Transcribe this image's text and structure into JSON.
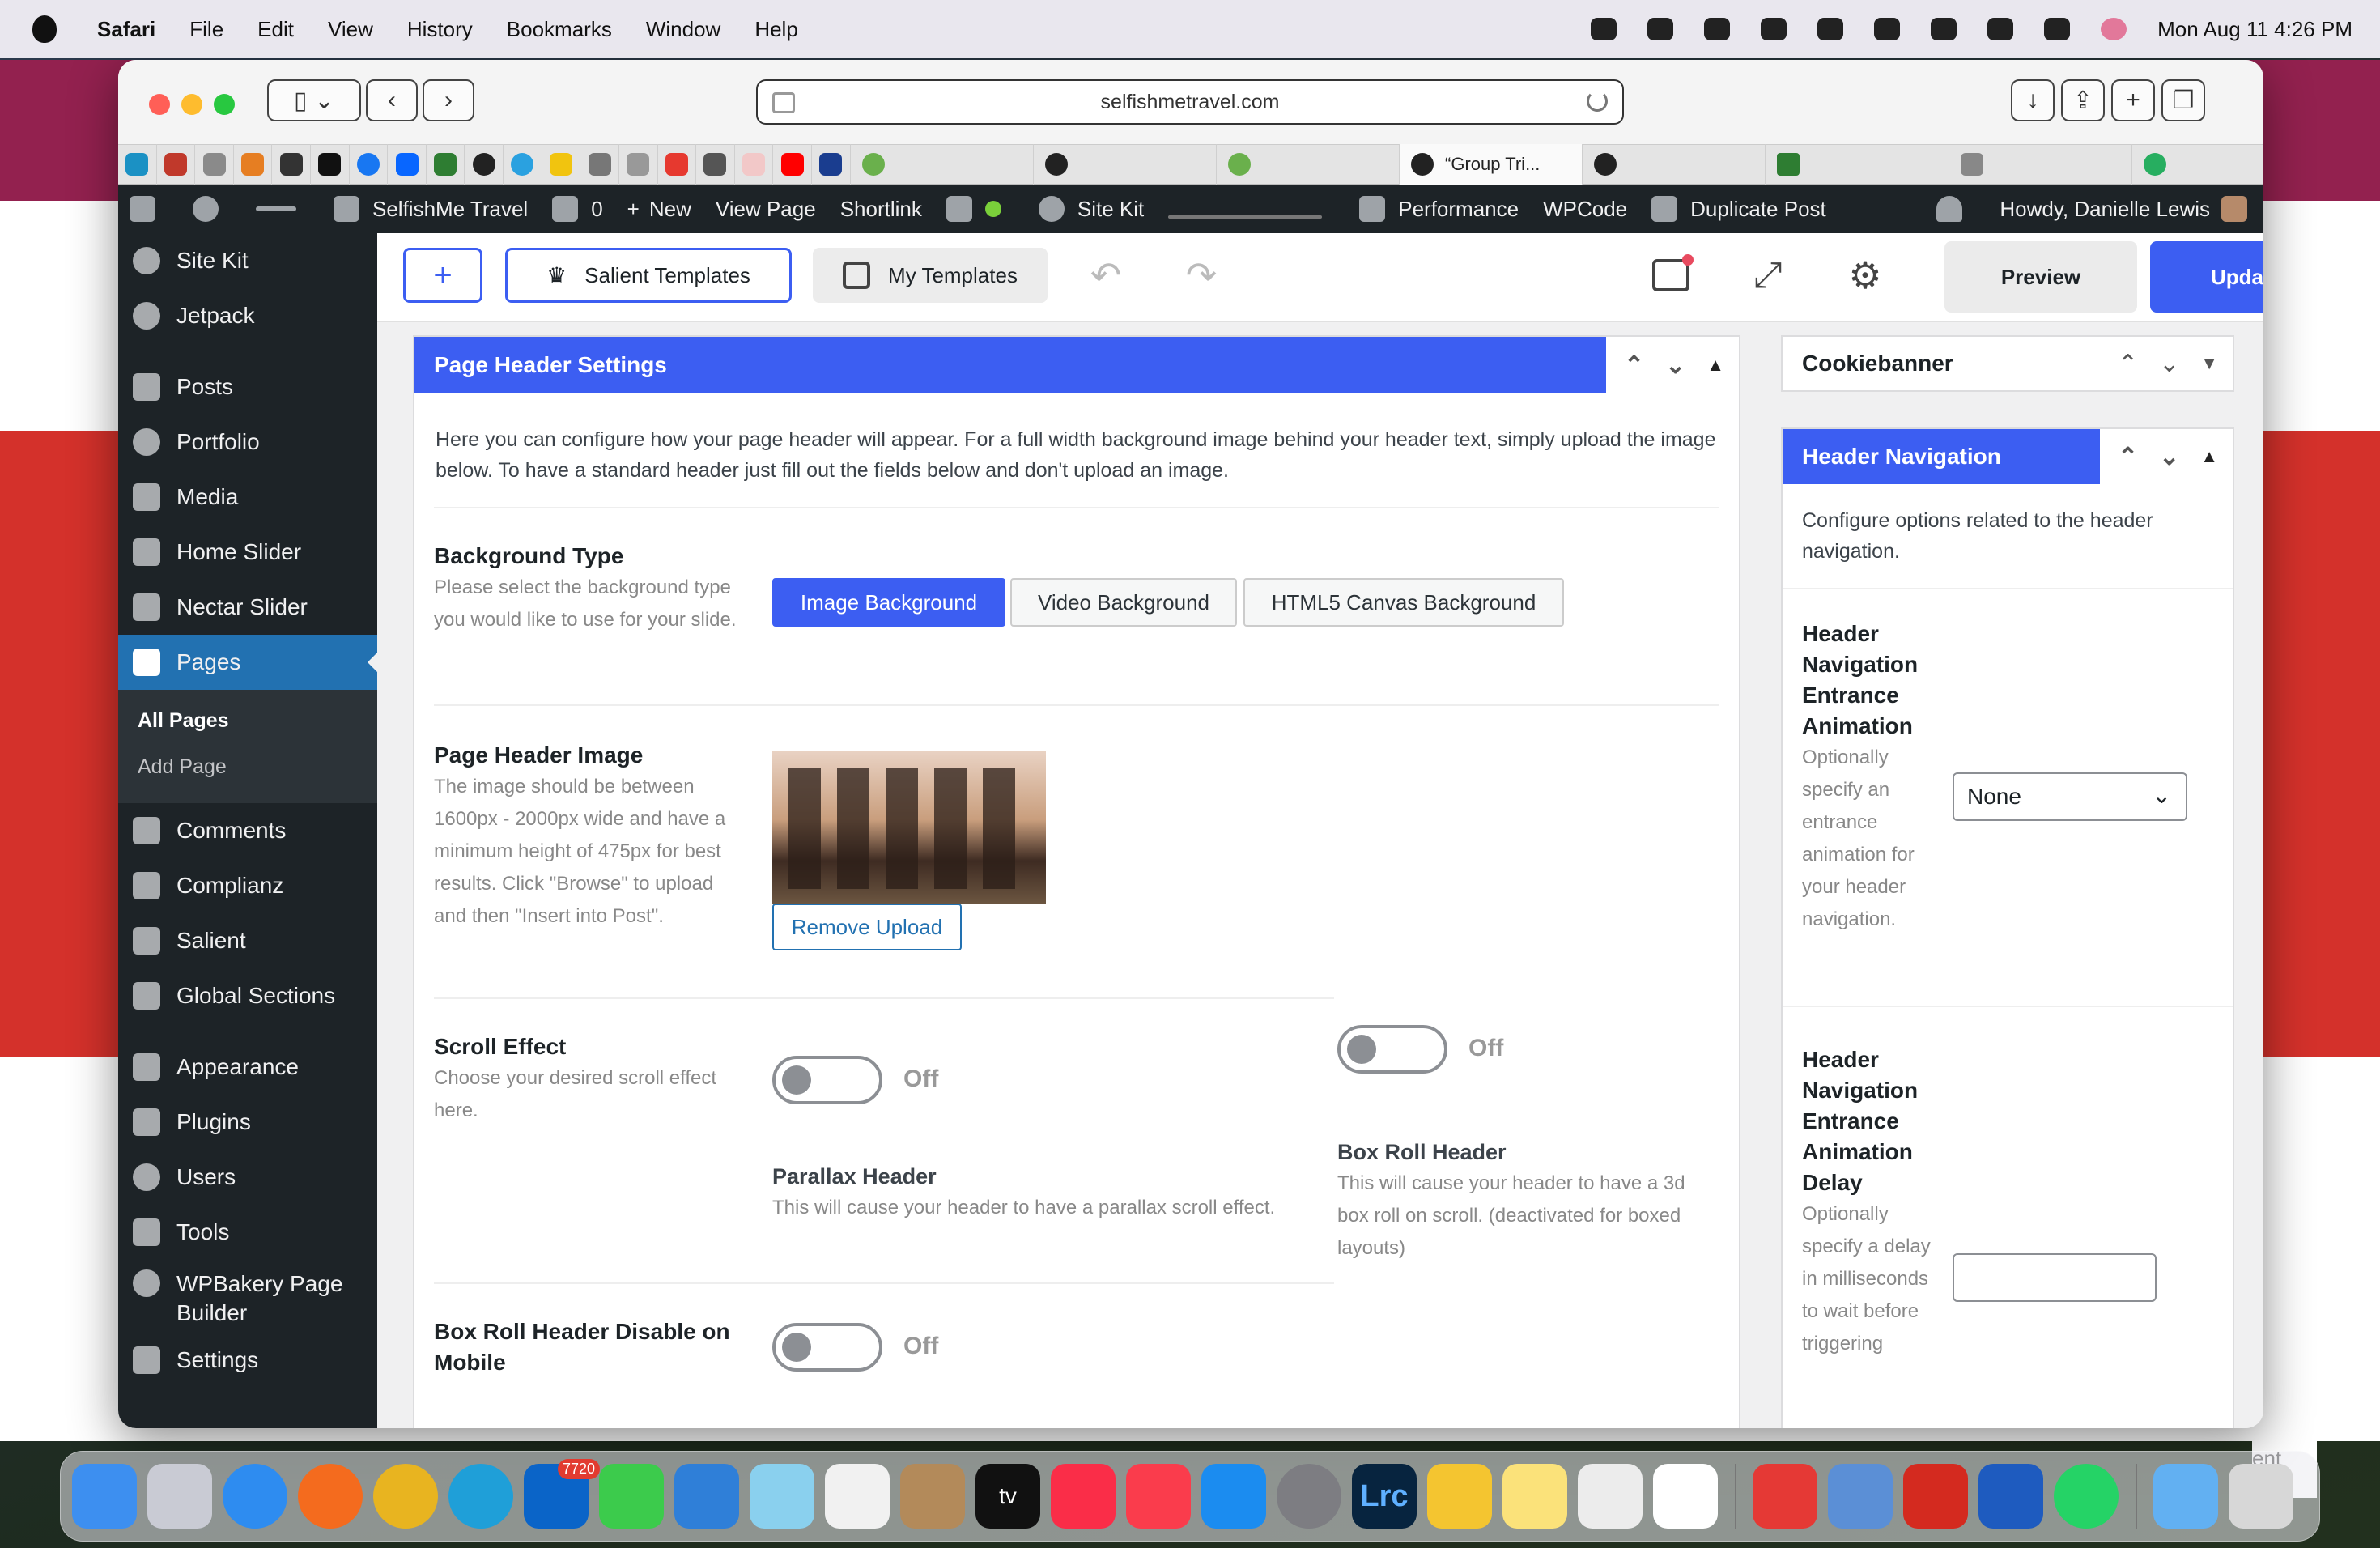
{
  "menubar": {
    "app": "Safari",
    "items": [
      "File",
      "Edit",
      "View",
      "History",
      "Bookmarks",
      "Window",
      "Help"
    ],
    "clock": "Mon Aug 11  4:26 PM"
  },
  "browser": {
    "url": "selfishmetravel.com",
    "tabs": [
      {
        "title": "“Group Tri..."
      }
    ]
  },
  "adminbar": {
    "site": "SelfishMe Travel",
    "comments": "0",
    "new": "New",
    "view_page": "View Page",
    "shortlink": "Shortlink",
    "site_kit": "Site Kit",
    "performance": "Performance",
    "wpcode": "WPCode",
    "duplicate": "Duplicate Post",
    "howdy": "Howdy, Danielle Lewis"
  },
  "sidebar": {
    "items": [
      "Site Kit",
      "Jetpack",
      "Posts",
      "Portfolio",
      "Media",
      "Home Slider",
      "Nectar Slider",
      "Pages",
      "Comments",
      "Complianz",
      "Salient",
      "Global Sections",
      "Appearance",
      "Plugins",
      "Users",
      "Tools",
      "WPBakery Page Builder",
      "Settings"
    ],
    "sub": [
      "All Pages",
      "Add Page"
    ]
  },
  "editor": {
    "salient_templates": "Salient Templates",
    "my_templates": "My Templates",
    "preview": "Preview",
    "update": "Update"
  },
  "page_header": {
    "title": "Page Header Settings",
    "intro": "Here you can configure how your page header will appear. For a full width background image behind your header text, simply upload the image below. To have a standard header just fill out the fields below and don't upload an image.",
    "bg_type_label": "Background Type",
    "bg_type_hint": "Please select the background type you would like to use for your slide.",
    "bg_options": [
      "Image Background",
      "Video Background",
      "HTML5 Canvas Background"
    ],
    "image_label": "Page Header Image",
    "image_hint": "The image should be between 1600px - 2000px wide and have a minimum height of 475px for best results. Click \"Browse\" to upload and then \"Insert into Post\".",
    "remove_upload": "Remove Upload",
    "scroll_label": "Scroll Effect",
    "scroll_hint": "Choose your desired scroll effect here.",
    "off": "Off",
    "parallax_title": "Parallax Header",
    "parallax_hint": "This will cause your header to have a parallax scroll effect.",
    "boxroll_title": "Box Roll Header",
    "boxroll_hint": "This will cause your header to have a 3d box roll on scroll. (deactivated for boxed layouts)",
    "boxroll_mobile_label": "Box Roll Header Disable on Mobile"
  },
  "right": {
    "cookiebanner": "Cookiebanner",
    "nav_title": "Header Navigation",
    "nav_intro": "Configure options related to the header navigation.",
    "anim_label": "Header Navigation Entrance Animation",
    "anim_hint": "Optionally specify an entrance animation for your header navigation.",
    "anim_value": "None",
    "delay_label": "Header Navigation Entrance Animation Delay",
    "delay_hint": "Optionally specify a delay in milliseconds to wait before triggering"
  },
  "background_window": {
    "pill_text": "ent"
  },
  "dock": {
    "outlook_badge": "7720",
    "tv_label": "tv",
    "lrc_label": "Lrc"
  }
}
